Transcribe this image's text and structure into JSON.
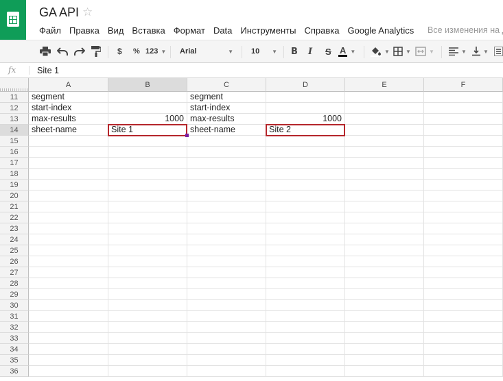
{
  "document": {
    "title": "GA API"
  },
  "menu": [
    "Файл",
    "Правка",
    "Вид",
    "Вставка",
    "Формат",
    "Data",
    "Инструменты",
    "Справка",
    "Google Analytics"
  ],
  "save_status": "Все изменения на Д",
  "toolbar": {
    "currency": "$",
    "percent": "%",
    "number_format": "123",
    "font": "Arial",
    "font_size": "10",
    "bold": "B",
    "italic": "I",
    "strike": "S",
    "text_color": "A",
    "accent_color": "#b5262b"
  },
  "formula_bar": {
    "fx": "fx",
    "value": "Site 1"
  },
  "grid": {
    "columns": [
      "A",
      "B",
      "C",
      "D",
      "E",
      "F"
    ],
    "selected_column": "B",
    "rows": [
      {
        "n": "11",
        "cells": [
          "segment",
          "",
          "segment",
          "",
          "",
          ""
        ]
      },
      {
        "n": "12",
        "cells": [
          "start-index",
          "",
          "start-index",
          "",
          "",
          ""
        ]
      },
      {
        "n": "13",
        "cells": [
          "max-results",
          "1000",
          "max-results",
          "1000",
          "",
          ""
        ]
      },
      {
        "n": "14",
        "cells": [
          "sheet-name",
          "Site 1",
          "sheet-name",
          "Site 2",
          "",
          ""
        ]
      },
      {
        "n": "15",
        "cells": [
          "",
          "",
          "",
          "",
          "",
          ""
        ]
      },
      {
        "n": "16",
        "cells": [
          "",
          "",
          "",
          "",
          "",
          ""
        ]
      },
      {
        "n": "17",
        "cells": [
          "",
          "",
          "",
          "",
          "",
          ""
        ]
      },
      {
        "n": "18",
        "cells": [
          "",
          "",
          "",
          "",
          "",
          ""
        ]
      },
      {
        "n": "19",
        "cells": [
          "",
          "",
          "",
          "",
          "",
          ""
        ]
      },
      {
        "n": "20",
        "cells": [
          "",
          "",
          "",
          "",
          "",
          ""
        ]
      },
      {
        "n": "21",
        "cells": [
          "",
          "",
          "",
          "",
          "",
          ""
        ]
      },
      {
        "n": "22",
        "cells": [
          "",
          "",
          "",
          "",
          "",
          ""
        ]
      },
      {
        "n": "23",
        "cells": [
          "",
          "",
          "",
          "",
          "",
          ""
        ]
      },
      {
        "n": "24",
        "cells": [
          "",
          "",
          "",
          "",
          "",
          ""
        ]
      },
      {
        "n": "25",
        "cells": [
          "",
          "",
          "",
          "",
          "",
          ""
        ]
      },
      {
        "n": "26",
        "cells": [
          "",
          "",
          "",
          "",
          "",
          ""
        ]
      },
      {
        "n": "27",
        "cells": [
          "",
          "",
          "",
          "",
          "",
          ""
        ]
      },
      {
        "n": "28",
        "cells": [
          "",
          "",
          "",
          "",
          "",
          ""
        ]
      },
      {
        "n": "29",
        "cells": [
          "",
          "",
          "",
          "",
          "",
          ""
        ]
      },
      {
        "n": "30",
        "cells": [
          "",
          "",
          "",
          "",
          "",
          ""
        ]
      },
      {
        "n": "31",
        "cells": [
          "",
          "",
          "",
          "",
          "",
          ""
        ]
      },
      {
        "n": "32",
        "cells": [
          "",
          "",
          "",
          "",
          "",
          ""
        ]
      },
      {
        "n": "33",
        "cells": [
          "",
          "",
          "",
          "",
          "",
          ""
        ]
      },
      {
        "n": "34",
        "cells": [
          "",
          "",
          "",
          "",
          "",
          ""
        ]
      },
      {
        "n": "35",
        "cells": [
          "",
          "",
          "",
          "",
          "",
          ""
        ]
      },
      {
        "n": "36",
        "cells": [
          "",
          "",
          "",
          "",
          "",
          ""
        ]
      }
    ],
    "selected_row": "14",
    "active_cell": "B14",
    "highlighted_cell": "D14"
  }
}
